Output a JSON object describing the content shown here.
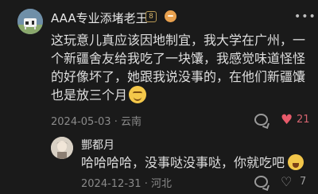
{
  "comment": {
    "username": "AAA专业添堵老王",
    "level": "8",
    "text": "这玩意儿真应该因地制宜，我大学在广州，一个新疆舍友给我吃了一块馕，我感觉味道怪怪的好像坏了，她跟我说没事的，在他们新疆馕也是放三个月",
    "emoji_icon": "sweat-smile-emoji",
    "date": "2024-05-03",
    "location": "云南",
    "likes": "21",
    "liked": true
  },
  "reply": {
    "username": "酆都月",
    "text": "哈哈哈哈，没事哒没事哒，你就吃吧",
    "emoji_icon": "drooling-emoji",
    "date": "2024-12-31",
    "location": "河北",
    "likes": "7"
  },
  "icons": {
    "more": "more-icon",
    "reply": "comment-bubble-icon",
    "like": "heart-icon"
  },
  "colors": {
    "background": "#1a1a1a",
    "like_active": "#e85a6a",
    "meta": "#8a8a8a"
  }
}
